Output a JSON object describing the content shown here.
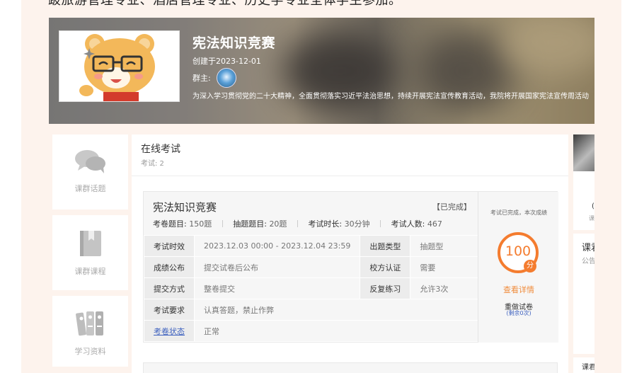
{
  "intro_text": "跛旅游管理专业、酒店管理专业、历史学专业全体学生参加。",
  "banner": {
    "title": "宪法知识竞赛",
    "created": "创建于2023-12-01",
    "owner_label": "群主:",
    "description": "为深入学习贯彻党的二十大精神，全面贯彻落实习近平法治思想，持续开展宪法宣传教育活动，我院将开展国家宪法宣传周活动"
  },
  "nav": {
    "topics": "课群话题",
    "courses": "课群课程",
    "materials": "学习资料"
  },
  "main": {
    "title": "在线考试",
    "count": "考试: 2"
  },
  "exam": {
    "name": "宪法知识竞赛",
    "status": "【已完成】",
    "stats": [
      {
        "label": "考卷题目:",
        "value": "150题"
      },
      {
        "label": "抽题题目:",
        "value": "20题"
      },
      {
        "label": "考试时长:",
        "value": "30分钟"
      },
      {
        "label": "考试人数:",
        "value": "467"
      }
    ],
    "rows": [
      {
        "k1": "考试时效",
        "v1": "2023.12.03 00:00 - 2023.12.04 23:59",
        "k2": "出题类型",
        "v2": "抽题型"
      },
      {
        "k1": "成绩公布",
        "v1": "提交试卷后公布",
        "k2": "校方认证",
        "v2": "需要"
      },
      {
        "k1": "提交方式",
        "v1": "整卷提交",
        "k2": "反复练习",
        "v2": "允许3次"
      }
    ],
    "req_label": "考试要求",
    "req_value": "认真答题，禁止作弊",
    "state_label": "考卷状态",
    "state_value": "正常",
    "score_note": "考试已完成，本次成绩",
    "score": "100",
    "score_unit": "分",
    "view_detail": "查看详情",
    "redo": "重做试卷",
    "remain": "(剩余0次)"
  },
  "right": {
    "frag1": "(",
    "frag2": "课",
    "frag3": "课君",
    "frag4": "公告",
    "frag5": "课君"
  },
  "colors": {
    "accent": "#f47c2f",
    "link": "#3b5fbe",
    "peach": "#fdf3ed"
  }
}
